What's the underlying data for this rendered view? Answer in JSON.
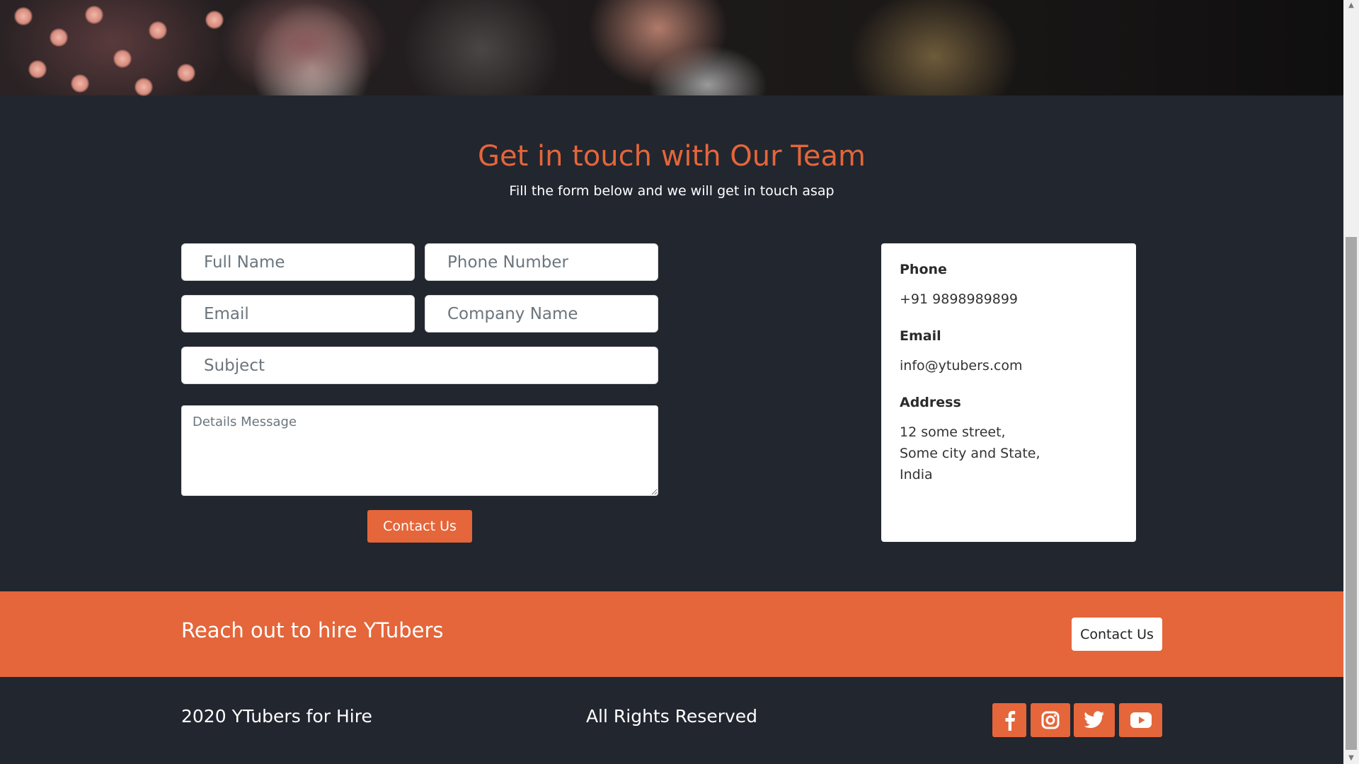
{
  "contact": {
    "title": "Get in touch with Our Team",
    "subtitle": "Fill the form below and we will get in touch asap",
    "form": {
      "full_name_placeholder": "Full Name",
      "phone_placeholder": "Phone Number",
      "email_placeholder": "Email",
      "company_placeholder": "Company Name",
      "subject_placeholder": "Subject",
      "message_placeholder": "Details Message",
      "submit_label": "Contact Us"
    },
    "info": {
      "phone_label": "Phone",
      "phone_value": "+91 9898989899",
      "email_label": "Email",
      "email_value": "info@ytubers.com",
      "address_label": "Address",
      "address_line1": "12 some street,",
      "address_line2": "Some city and State,",
      "address_line3": "India"
    }
  },
  "cta": {
    "text": "Reach out to hire YTubers",
    "button_label": "Contact Us"
  },
  "footer": {
    "left_text": "2020 YTubers for Hire",
    "center_text": "All Rights Reserved",
    "social": [
      "facebook-icon",
      "instagram-icon",
      "twitter-icon",
      "youtube-icon"
    ]
  },
  "colors": {
    "accent": "#e4663a",
    "background": "#22262f",
    "card": "#ffffff"
  }
}
